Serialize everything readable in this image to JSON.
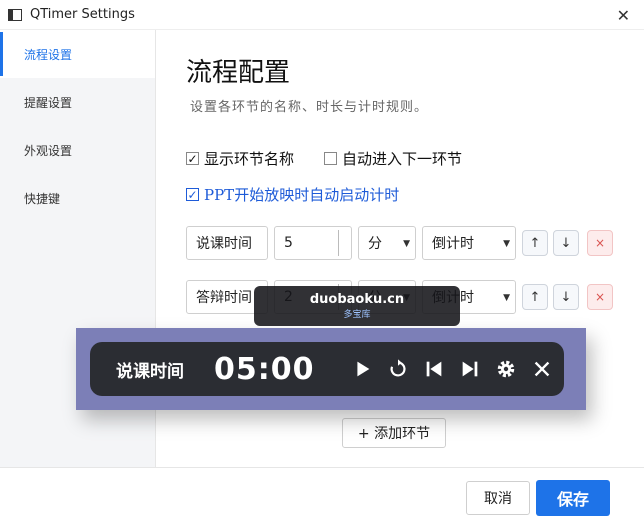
{
  "window": {
    "title": "QTimer Settings",
    "close_icon": "close-icon"
  },
  "sidebar": {
    "items": [
      {
        "label": "流程设置",
        "active": true
      },
      {
        "label": "提醒设置",
        "active": false
      },
      {
        "label": "外观设置",
        "active": false
      },
      {
        "label": "快捷键",
        "active": false
      }
    ]
  },
  "main": {
    "title": "流程配置",
    "subtitle": "设置各环节的名称、时长与计时规则。",
    "options": {
      "show_name": {
        "label": "显示环节名称",
        "checked": true
      },
      "auto_next": {
        "label": "自动进入下一环节",
        "checked": false
      },
      "ppt_auto": {
        "label": "PPT开始放映时自动启动计时",
        "checked": true
      }
    },
    "rows": [
      {
        "name": "说课时间",
        "duration": "5",
        "unit": "分",
        "mode": "倒计时"
      },
      {
        "name": "答辩时间",
        "duration": "2",
        "unit": "分",
        "mode": "倒计时"
      }
    ],
    "row_buttons": {
      "up": "↑",
      "down": "↓",
      "delete": "×"
    },
    "add_button": "+ 添加环节"
  },
  "footer": {
    "cancel": "取消",
    "save": "保存"
  },
  "timer_overlay": {
    "segment": "说课时间",
    "time": "05:00"
  },
  "watermark": {
    "main": "duobaoku.cn",
    "sub": "多宝库"
  },
  "colors": {
    "accent": "#1e73e8",
    "timer_bg": "#2b2d33",
    "overlay_frame": "#7c7fb7",
    "delete": "#d9534f"
  }
}
